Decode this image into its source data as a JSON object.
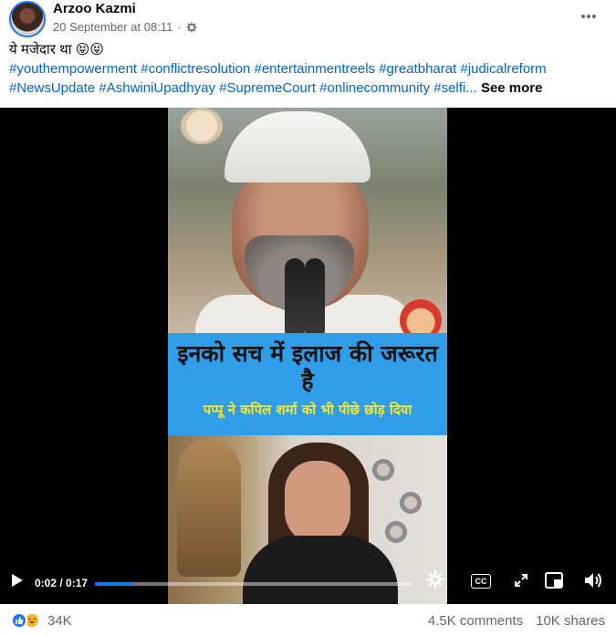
{
  "post": {
    "author": "Arzoo Kazmi",
    "timestamp": "20 September at 08:11",
    "separator": "·",
    "privacy_icon": "gear-globe-icon",
    "more_icon": "three-dots-icon",
    "caption": "ये मजेदार था 😝😝",
    "hashtags": "#youthempowerment #conflictresolution #entertainmentreels #greatbharat #judicalreform #NewsUpdate #AshwiniUpadhyay #SupremeCourt #onlinecommunity #selfi...",
    "see_more": "See more"
  },
  "video": {
    "banner_title": "इनको सच में इलाज की जरूरत है",
    "banner_subtitle": "पप्पू ने कपिल शर्मा को भी पीछे छोड़ दिया",
    "time": "0:02 / 0:17",
    "progress_fraction": 0.12,
    "controls": {
      "play_icon": "play-icon",
      "settings_icon": "settings-icon",
      "captions_label": "CC",
      "expand_icon": "expand-icon",
      "pip_icon": "picture-in-picture-icon",
      "volume_icon": "volume-icon"
    }
  },
  "footer": {
    "reaction_count": "34K",
    "comments": "4.5K comments",
    "shares": "10K shares"
  },
  "colors": {
    "link": "#0064d1",
    "accent": "#1877f2",
    "banner": "#2f9de8",
    "banner_subtitle": "#ffe814"
  }
}
